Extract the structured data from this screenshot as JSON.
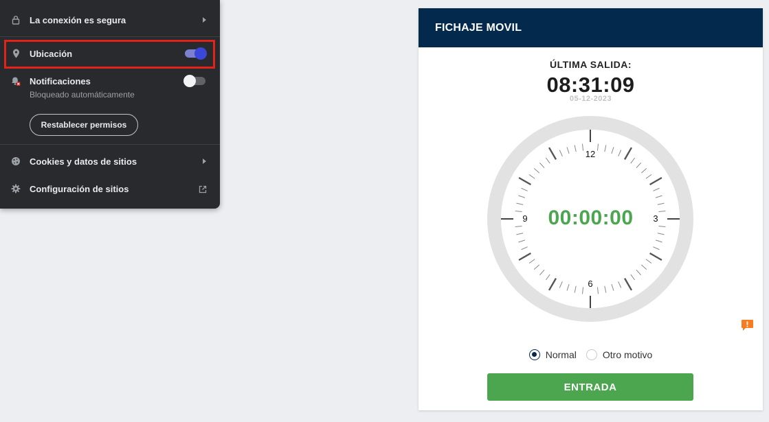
{
  "popup": {
    "connection": {
      "label": "La conexión es segura",
      "icon": "lock-icon"
    },
    "location": {
      "label": "Ubicación",
      "icon": "location-pin-icon",
      "enabled": true
    },
    "notifications": {
      "label": "Notificaciones",
      "subtitle": "Bloqueado automáticamente",
      "icon": "notifications-blocked-icon",
      "enabled": false
    },
    "reset_button": "Restablecer permisos",
    "cookies": {
      "label": "Cookies y datos de sitios",
      "icon": "cookie-icon"
    },
    "site_settings": {
      "label": "Configuración de sitios",
      "icon": "gear-icon"
    }
  },
  "card": {
    "title": "FICHAJE MOVIL",
    "last_label": "ÚLTIMA SALIDA:",
    "last_time": "08:31:09",
    "last_date": "05-12-2023",
    "clock": {
      "numerals": {
        "n12": "12",
        "n3": "3",
        "n6": "6",
        "n9": "9"
      },
      "elapsed": "00:00:00"
    },
    "radio_options": {
      "normal": "Normal",
      "other": "Otro motivo"
    },
    "selected_option": "normal",
    "submit_button": "ENTRADA"
  },
  "colors": {
    "header_bg": "#032a4d",
    "accent_green": "#4ca64f",
    "toggle_on": "#3b46db",
    "highlight": "#e2231a",
    "alert": "#f57c20"
  }
}
